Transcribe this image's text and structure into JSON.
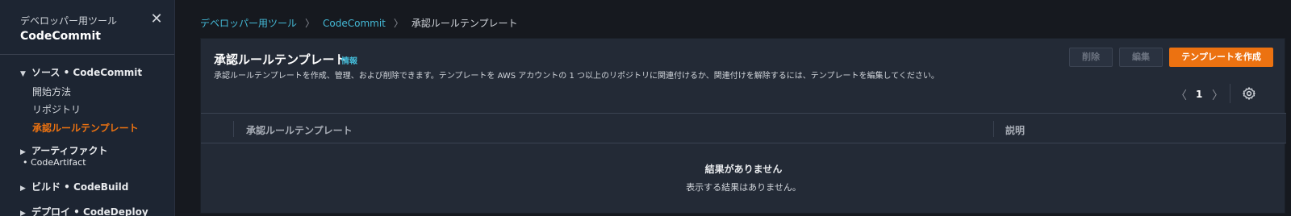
{
  "sidebar": {
    "subtitle": "デベロッパー用ツール",
    "title": "CodeCommit",
    "sections": [
      {
        "label": "ソース • CodeCommit",
        "expanded": true
      },
      {
        "label": "アーティファクト",
        "sub": "• CodeArtifact",
        "expanded": false
      },
      {
        "label": "ビルド • CodeBuild",
        "expanded": false
      },
      {
        "label": "デプロイ • CodeDeploy",
        "expanded": false
      }
    ],
    "items": [
      "開始方法",
      "リポジトリ",
      "承認ルールテンプレート"
    ]
  },
  "breadcrumb": [
    "デベロッパー用ツール",
    "CodeCommit",
    "承認ルールテンプレート"
  ],
  "panel": {
    "title": "承認ルールテンプレート",
    "info": "情報",
    "description": "承認ルールテンプレートを作成、管理、および削除できます。テンプレートを AWS アカウントの 1 つ以上のリポジトリに関連付けるか、関連付けを解除するには、テンプレートを編集してください。",
    "buttons": {
      "delete": "削除",
      "edit": "編集",
      "create": "テンプレートを作成"
    },
    "pagination": {
      "page": "1"
    },
    "columns": [
      "承認ルールテンプレート",
      "説明"
    ],
    "empty": {
      "title": "結果がありません",
      "description": "表示する結果はありません。"
    }
  },
  "colors": {
    "accent": "#ec7211",
    "link": "#44b9d6"
  }
}
